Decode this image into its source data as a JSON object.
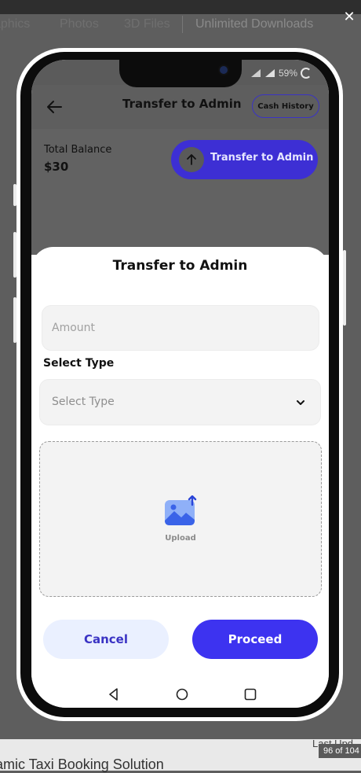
{
  "background_site": {
    "nav_items": [
      "aphics",
      "Photos",
      "3D Files",
      "Unlimited Downloads"
    ],
    "close_icon": "close-icon",
    "product_title": "amic Taxi Booking Solution",
    "last_updated_partial": "Last Upd",
    "page_counter": "96 of 104"
  },
  "status_bar": {
    "battery": "59%",
    "icons": [
      "network-icon",
      "signal-icon",
      "battery-icon"
    ]
  },
  "header": {
    "back_icon": "back-arrow-icon",
    "title": "Transfer to Admin",
    "cash_history_label": "Cash History"
  },
  "balance": {
    "label": "Total Balance",
    "value": "$30"
  },
  "transfer_button": {
    "icon": "arrow-up-icon",
    "label": "Transfer to Admin"
  },
  "sheet": {
    "title": "Transfer to Admin",
    "amount": {
      "placeholder": "Amount",
      "value": ""
    },
    "select_type_label": "Select Type",
    "select_type": {
      "placeholder": "Select Type",
      "icon": "chevron-down-icon"
    },
    "upload": {
      "icon": "image-upload-icon",
      "label": "Upload"
    },
    "cancel_label": "Cancel",
    "proceed_label": "Proceed"
  },
  "android_nav": {
    "icons": [
      "nav-back-icon",
      "nav-home-icon",
      "nav-recents-icon"
    ]
  },
  "colors": {
    "primary": "#3d33f0",
    "primary_dark": "#3d2fd4",
    "cancel_bg": "#eaf0ff",
    "field_bg": "#f3f3f3"
  }
}
